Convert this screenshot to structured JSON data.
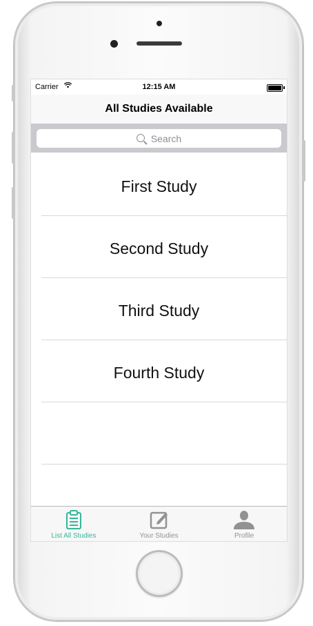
{
  "status_bar": {
    "carrier": "Carrier",
    "time": "12:15 AM"
  },
  "nav": {
    "title": "All Studies Available"
  },
  "search": {
    "placeholder": "Search"
  },
  "studies": [
    {
      "title": "First Study"
    },
    {
      "title": "Second Study"
    },
    {
      "title": "Third Study"
    },
    {
      "title": "Fourth Study"
    },
    {
      "title": ""
    },
    {
      "title": ""
    }
  ],
  "tabs": [
    {
      "label": "List All Studies",
      "icon": "clipboard-icon",
      "active": true
    },
    {
      "label": "Your Studies",
      "icon": "edit-icon",
      "active": false
    },
    {
      "label": "Profile",
      "icon": "person-icon",
      "active": false
    }
  ],
  "colors": {
    "accent": "#34b79a",
    "inactive": "#929292",
    "search_bar": "#c9c9ce"
  }
}
